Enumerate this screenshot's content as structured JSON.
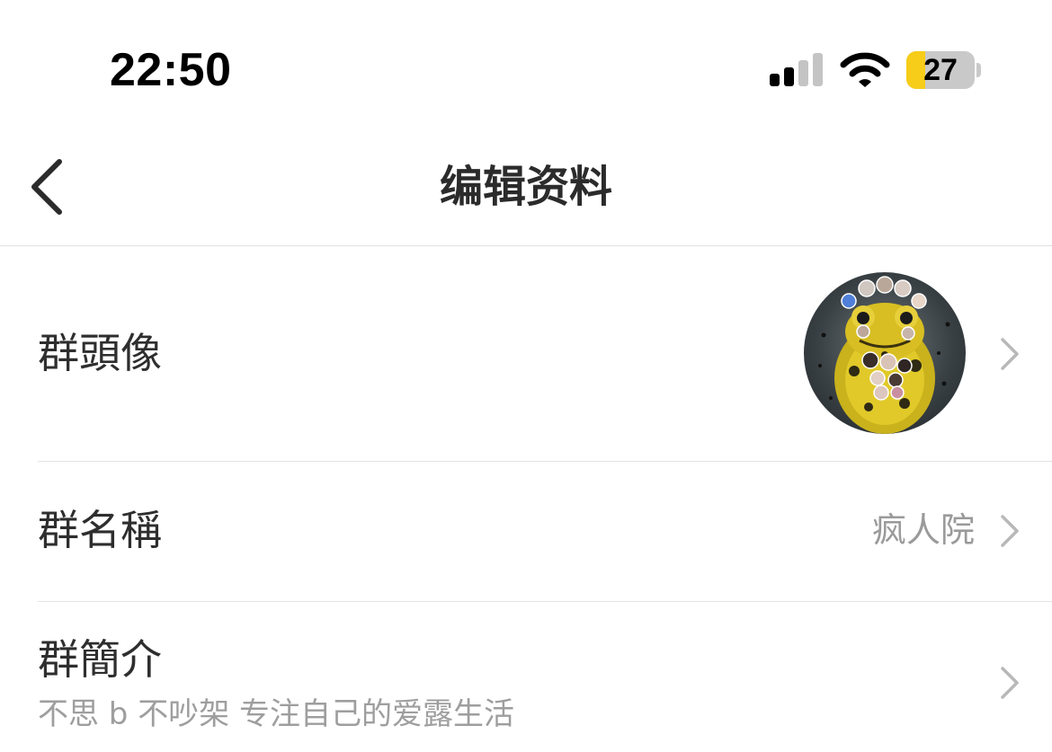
{
  "status_bar": {
    "time": "22:50",
    "battery_level": "27",
    "battery_fraction": 0.27,
    "signal_bars_active": 2,
    "signal_bars_total": 4,
    "battery_fill_color": "#f7cd1a"
  },
  "nav": {
    "title": "编辑资料",
    "back_icon": "chevron-left-icon"
  },
  "rows": [
    {
      "label": "群頭像",
      "value_type": "avatar",
      "chevron_icon": "chevron-right-icon"
    },
    {
      "label": "群名稱",
      "value": "疯人院",
      "chevron_icon": "chevron-right-icon"
    },
    {
      "label": "群簡介",
      "subtitle": "不思 b 不吵架 专注自己的爱露生活",
      "chevron_icon": "chevron-right-icon"
    }
  ],
  "colors": {
    "label_text": "#2e2e2e",
    "secondary_text": "#9a9a9a",
    "divider": "#e3e3e3",
    "chevron": "#b8b8b8"
  }
}
